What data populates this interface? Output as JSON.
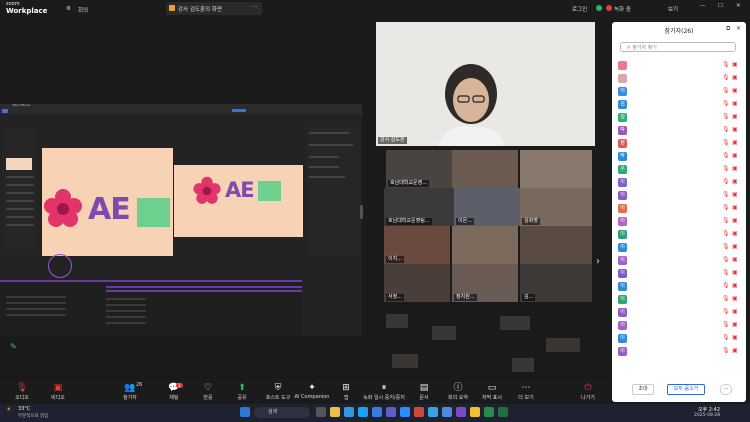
{
  "app": {
    "brand_small": "zoom",
    "brand": "Workplace"
  },
  "top": {
    "meeting_label": "회의",
    "share_title": "강사 김도훈의 화면",
    "login": "로그인",
    "record": "녹화 중",
    "view": "보기"
  },
  "ae": {
    "title": "After Effects",
    "logo": "AE"
  },
  "speaker": {
    "name": "강사 김도훈"
  },
  "tiles": [
    {
      "name": "호남대학교운영..."
    },
    {
      "name": "호남대학교운영팀..."
    },
    {
      "name": "이은..."
    },
    {
      "name": "김화영"
    },
    {
      "name": "이지..."
    },
    {
      "name": "서정..."
    },
    {
      "name": "정지원..."
    },
    {
      "name": "김..."
    }
  ],
  "panel": {
    "title": "참가자(26)",
    "search_placeholder": "참가자 찾기",
    "rows": [
      {
        "initial": "",
        "color": "#e97b8a"
      },
      {
        "initial": "",
        "color": "#d9a6b0"
      },
      {
        "initial": "이",
        "color": "#3a8be3"
      },
      {
        "initial": "김",
        "color": "#2f8ad8"
      },
      {
        "initial": "김",
        "color": "#2bb07a"
      },
      {
        "initial": "박",
        "color": "#9b59b6"
      },
      {
        "initial": "정",
        "color": "#e15757"
      },
      {
        "initial": "박",
        "color": "#2e8bd6"
      },
      {
        "initial": "우",
        "color": "#2fa77a"
      },
      {
        "initial": "이",
        "color": "#7b61c8"
      },
      {
        "initial": "이",
        "color": "#8d5cc4"
      },
      {
        "initial": "이",
        "color": "#e06a50"
      },
      {
        "initial": "이",
        "color": "#b563c9"
      },
      {
        "initial": "이",
        "color": "#2e9d7b"
      },
      {
        "initial": "이",
        "color": "#2f8ad8"
      },
      {
        "initial": "이",
        "color": "#9f62c9"
      },
      {
        "initial": "이",
        "color": "#7a5bd0"
      },
      {
        "initial": "이",
        "color": "#2e8bd6"
      },
      {
        "initial": "이",
        "color": "#2ea56f"
      },
      {
        "initial": "이",
        "color": "#8e5bc7"
      },
      {
        "initial": "이",
        "color": "#a063c7"
      },
      {
        "initial": "이",
        "color": "#2f8ad8"
      },
      {
        "initial": "이",
        "color": "#9a5fc6"
      }
    ],
    "invite": "초대",
    "mute_all": "모두 음소거",
    "more": "..."
  },
  "toolbar": {
    "audio": "오디오",
    "video": "비디오",
    "participants": "참가자",
    "participant_count": "26",
    "chat": "채팅",
    "chat_badge": "1",
    "react": "반응",
    "share": "공유",
    "host_tools": "호스트 도구",
    "ai": "AI Companion",
    "apps": "앱",
    "record": "녹화 일시 중지/중지",
    "docs": "문서",
    "summary": "회의 요약",
    "captions": "자막 표시",
    "more": "더 보기",
    "leave": "나가기"
  },
  "taskbar": {
    "weather_temp": "33°C",
    "weather_text": "부분적으로 맑음",
    "search": "검색",
    "time": "오후 2:42",
    "date": "2025-08-28"
  }
}
